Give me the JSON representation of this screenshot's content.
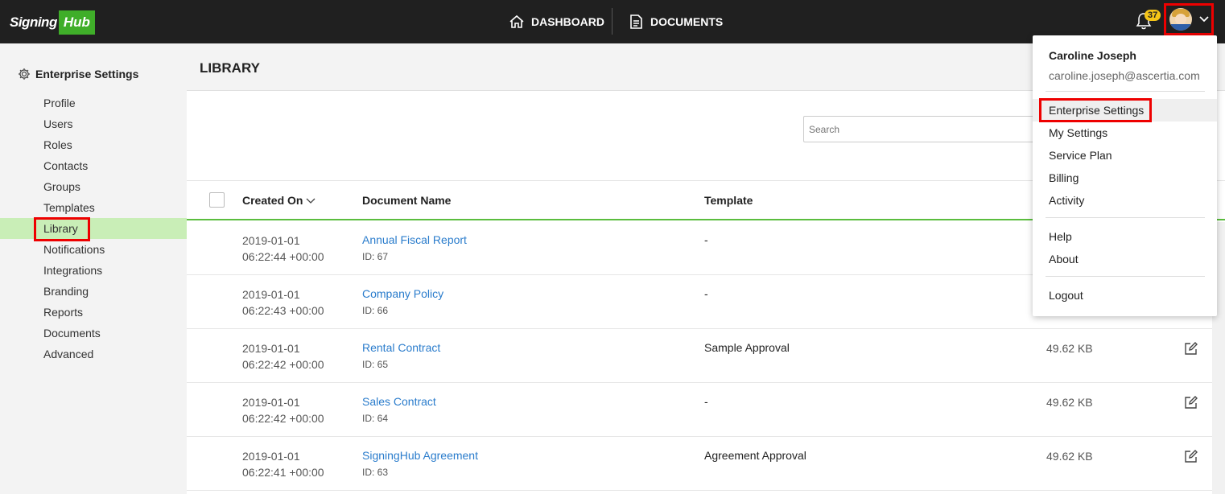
{
  "brand": {
    "sig": "Signing",
    "hub": "Hub",
    "accent": "#3fae29"
  },
  "nav": {
    "dashboard": "DASHBOARD",
    "documents": "DOCUMENTS"
  },
  "notifications": {
    "count": "37"
  },
  "sidebar": {
    "title": "Enterprise Settings",
    "items": [
      {
        "label": "Profile"
      },
      {
        "label": "Users"
      },
      {
        "label": "Roles"
      },
      {
        "label": "Contacts"
      },
      {
        "label": "Groups"
      },
      {
        "label": "Templates"
      },
      {
        "label": "Library"
      },
      {
        "label": "Notifications"
      },
      {
        "label": "Integrations"
      },
      {
        "label": "Branding"
      },
      {
        "label": "Reports"
      },
      {
        "label": "Documents"
      },
      {
        "label": "Advanced"
      }
    ],
    "active": "Library"
  },
  "main": {
    "title": "LIBRARY",
    "search_placeholder": "Search",
    "columns": {
      "created": "Created On",
      "name": "Document Name",
      "template": "Template"
    },
    "rows": [
      {
        "date": "2019-01-01",
        "time": "06:22:44 +00:00",
        "name": "Annual Fiscal Report",
        "id": "ID: 67",
        "template": "-",
        "size": ""
      },
      {
        "date": "2019-01-01",
        "time": "06:22:43 +00:00",
        "name": "Company Policy",
        "id": "ID: 66",
        "template": "-",
        "size": ""
      },
      {
        "date": "2019-01-01",
        "time": "06:22:42 +00:00",
        "name": "Rental Contract",
        "id": "ID: 65",
        "template": "Sample Approval",
        "size": "49.62 KB"
      },
      {
        "date": "2019-01-01",
        "time": "06:22:42 +00:00",
        "name": "Sales Contract",
        "id": "ID: 64",
        "template": "-",
        "size": "49.62 KB"
      },
      {
        "date": "2019-01-01",
        "time": "06:22:41 +00:00",
        "name": "SigningHub Agreement",
        "id": "ID: 63",
        "template": "Agreement Approval",
        "size": "49.62 KB"
      }
    ]
  },
  "user_menu": {
    "name": "Caroline Joseph",
    "email": "caroline.joseph@ascertia.com",
    "items": [
      "Enterprise Settings",
      "My Settings",
      "Service Plan",
      "Billing",
      "Activity"
    ],
    "help_items": [
      "Help",
      "About"
    ],
    "logout": "Logout"
  }
}
